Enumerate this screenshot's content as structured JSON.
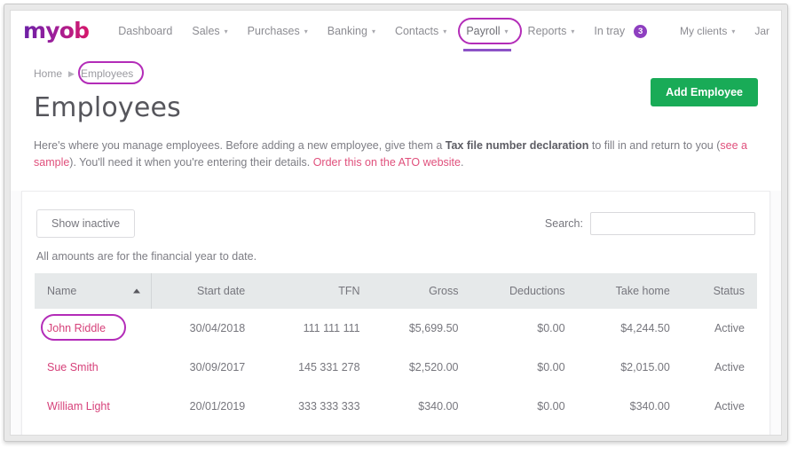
{
  "topnav": {
    "logo": "myob",
    "items": [
      {
        "label": "Dashboard",
        "caret": false,
        "active": false
      },
      {
        "label": "Sales",
        "caret": true,
        "active": false
      },
      {
        "label": "Purchases",
        "caret": true,
        "active": false
      },
      {
        "label": "Banking",
        "caret": true,
        "active": false
      },
      {
        "label": "Contacts",
        "caret": true,
        "active": false
      },
      {
        "label": "Payroll",
        "caret": true,
        "active": true
      },
      {
        "label": "Reports",
        "caret": true,
        "active": false
      }
    ],
    "in_tray": {
      "label": "In tray",
      "count": "3"
    },
    "my_clients": {
      "label": "My clients",
      "caret": true
    },
    "user": "Jar"
  },
  "breadcrumb": {
    "home": "Home",
    "separator": "▶",
    "current": "Employees"
  },
  "header": {
    "title": "Employees",
    "add_button": "Add Employee"
  },
  "intro": {
    "part1": "Here's where you manage employees. Before adding a new employee, give them a ",
    "bold1": "Tax file number declaration",
    "part2": " to fill in and return to you (",
    "link1": "see a sample",
    "part3": "). You'll need it when you're entering their details. ",
    "link2": "Order this on the ATO website",
    "part4": "."
  },
  "toolbar": {
    "show_inactive": "Show inactive",
    "search_label": "Search:",
    "search_value": "",
    "search_placeholder": ""
  },
  "amounts_note": "All amounts are for the financial year to date.",
  "table": {
    "columns": [
      {
        "label": "Name",
        "align": "left"
      },
      {
        "label": "Start date",
        "align": "right"
      },
      {
        "label": "TFN",
        "align": "right"
      },
      {
        "label": "Gross",
        "align": "right"
      },
      {
        "label": "Deductions",
        "align": "right"
      },
      {
        "label": "Take home",
        "align": "right"
      },
      {
        "label": "Status",
        "align": "right"
      }
    ],
    "sort": {
      "column": "Name",
      "direction": "asc"
    },
    "rows": [
      {
        "name": "John Riddle",
        "start_date": "30/04/2018",
        "tfn": "111 111 111",
        "gross": "$5,699.50",
        "deductions": "$0.00",
        "take_home": "$4,244.50",
        "status": "Active"
      },
      {
        "name": "Sue Smith",
        "start_date": "30/09/2017",
        "tfn": "145 331 278",
        "gross": "$2,520.00",
        "deductions": "$0.00",
        "take_home": "$2,015.00",
        "status": "Active"
      },
      {
        "name": "William Light",
        "start_date": "20/01/2019",
        "tfn": "333 333 333",
        "gross": "$340.00",
        "deductions": "$0.00",
        "take_home": "$340.00",
        "status": "Active"
      }
    ]
  },
  "annotations": {
    "color": "#b32cb8",
    "targets": [
      "Payroll menu",
      "Employees breadcrumb",
      "John Riddle link"
    ]
  },
  "colors": {
    "brand_purple": "#8e3fc0",
    "brand_magenta": "#d6186a",
    "accent_green": "#19ab57",
    "link_pink": "#e0507c",
    "highlight": "#b32cb8"
  }
}
